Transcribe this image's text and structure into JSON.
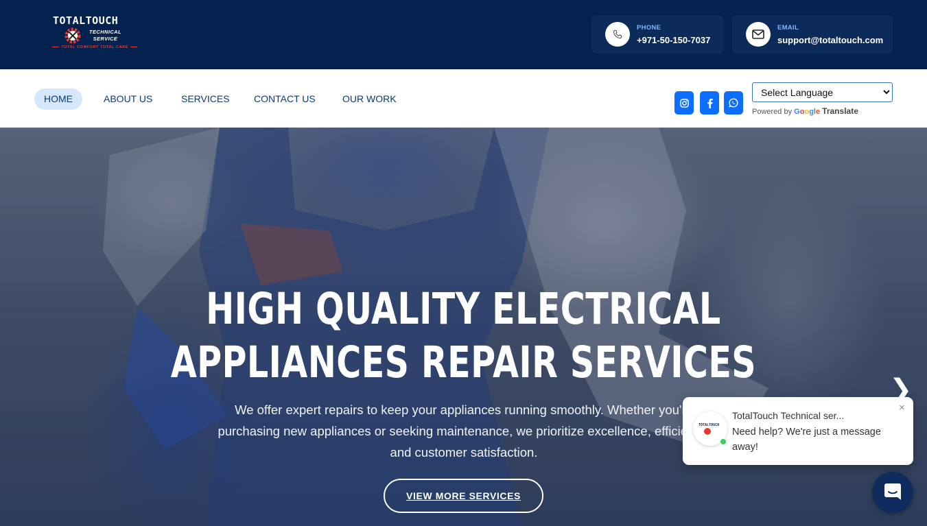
{
  "logo": {
    "title": "TOTALTOUCH",
    "subtitle_line1": "TECHNICAL",
    "subtitle_line2": "SERVICE",
    "tagline": "TOTAL COMFORT TOTAL CARE"
  },
  "header": {
    "phone": {
      "label": "PHONE",
      "value": "+971-50-150-7037",
      "icon": "phone-icon"
    },
    "email": {
      "label": "EMAIL",
      "value": "support@totaltouch.com",
      "icon": "mail-icon"
    }
  },
  "nav": {
    "items": [
      {
        "label": "HOME",
        "active": true
      },
      {
        "label": "ABOUT US",
        "active": false
      },
      {
        "label": "SERVICES",
        "active": false
      },
      {
        "label": "CONTACT US",
        "active": false
      },
      {
        "label": "OUR WORK",
        "active": false
      }
    ],
    "social": [
      "instagram-icon",
      "facebook-icon",
      "whatsapp-icon"
    ],
    "language": {
      "selected": "Select Language",
      "powered_by": "Powered by",
      "google": "Google",
      "translate": "Translate"
    }
  },
  "hero": {
    "title_line1": "HIGH QUALITY ELECTRICAL",
    "title_line2": "APPLIANCES REPAIR SERVICES",
    "text": "We offer expert repairs to keep your appliances running smoothly. Whether you're purchasing new appliances or seeking maintenance, we prioritize excellence, efficiency, and customer satisfaction.",
    "button": "VIEW MORE SERVICES",
    "next_arrow": "❯"
  },
  "chat": {
    "name": "TotalTouch Technical ser...",
    "message": "Need help? We're just a message away!",
    "close": "×",
    "avatar_text": "TOTALTOUCH"
  },
  "colors": {
    "header_bg": "#04224f",
    "accent": "#0d6efd",
    "nav_text": "#0c3a78",
    "nav_active_bg": "#d6e7fb",
    "logo_red": "#e43a2f",
    "online": "#31d15b"
  }
}
